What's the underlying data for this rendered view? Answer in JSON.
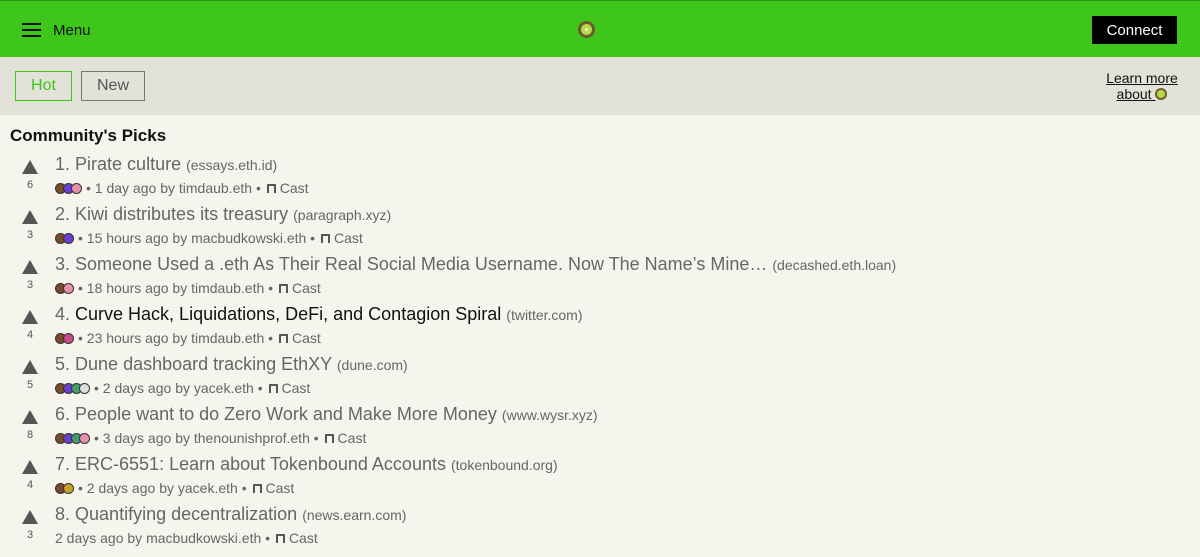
{
  "header": {
    "menu_label": "Menu",
    "logo_icon": "kiwi-icon",
    "connect_label": "Connect",
    "brand_color": "#3fc61b"
  },
  "tabs": [
    {
      "label": "Hot",
      "active": true
    },
    {
      "label": "New",
      "active": false
    }
  ],
  "learn_more": {
    "line1": "Learn more",
    "line2": "about"
  },
  "section_title": "Community's Picks",
  "stories": [
    {
      "rank": "1.",
      "title": "Pirate culture",
      "domain": "(essays.eth.id)",
      "votes": "6",
      "time": "1 day ago",
      "by": "by",
      "author": "timdaub.eth",
      "cast": "Cast",
      "avatars": [
        "#7a4b2a",
        "#6b3fd1",
        "#e88fb0"
      ],
      "visited": false
    },
    {
      "rank": "2.",
      "title": "Kiwi distributes its treasury",
      "domain": "(paragraph.xyz)",
      "votes": "3",
      "time": "15 hours ago",
      "by": "by",
      "author": "macbudkowski.eth",
      "cast": "Cast",
      "avatars": [
        "#7a4b2a",
        "#6b3fd1"
      ],
      "visited": false
    },
    {
      "rank": "3.",
      "title": "Someone Used a .eth As Their Real Social Media Username. Now The Name’s Mine…",
      "domain": "(decashed.eth.loan)",
      "votes": "3",
      "time": "18 hours ago",
      "by": "by",
      "author": "timdaub.eth",
      "cast": "Cast",
      "avatars": [
        "#7a4b2a",
        "#e88fb0"
      ],
      "visited": false
    },
    {
      "rank": "4.",
      "title": "Curve Hack, Liquidations, DeFi, and Contagion Spiral",
      "domain": "(twitter.com)",
      "votes": "4",
      "time": "23 hours ago",
      "by": "by",
      "author": "timdaub.eth",
      "cast": "Cast",
      "avatars": [
        "#7a4b2a",
        "#c94a8a"
      ],
      "visited": true
    },
    {
      "rank": "5.",
      "title": "Dune dashboard tracking EthXY",
      "domain": "(dune.com)",
      "votes": "5",
      "time": "2 days ago",
      "by": "by",
      "author": "yacek.eth",
      "cast": "Cast",
      "avatars": [
        "#7a4b2a",
        "#6b3fd1",
        "#3fa06b",
        "#dddddd"
      ],
      "visited": false
    },
    {
      "rank": "6.",
      "title": "People want to do Zero Work and Make More Money",
      "domain": "(www.wysr.xyz)",
      "votes": "8",
      "time": "3 days ago",
      "by": "by",
      "author": "thenounishprof.eth",
      "cast": "Cast",
      "avatars": [
        "#7a4b2a",
        "#6b3fd1",
        "#3fa06b",
        "#e88fb0"
      ],
      "visited": false
    },
    {
      "rank": "7.",
      "title": "ERC-6551: Learn about Tokenbound Accounts",
      "domain": "(tokenbound.org)",
      "votes": "4",
      "time": "2 days ago",
      "by": "by",
      "author": "yacek.eth",
      "cast": "Cast",
      "avatars": [
        "#7a4b2a",
        "#c9a02a"
      ],
      "visited": false
    },
    {
      "rank": "8.",
      "title": "Quantifying decentralization",
      "domain": "(news.earn.com)",
      "votes": "3",
      "time": "2 days ago",
      "by": "by",
      "author": "macbudkowski.eth",
      "cast": "Cast",
      "avatars": [],
      "visited": false
    }
  ]
}
